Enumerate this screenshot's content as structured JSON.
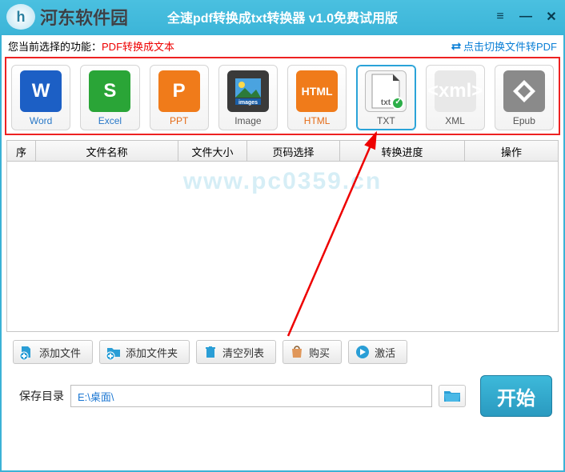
{
  "titlebar": {
    "brand": "河东软件园",
    "title": "全速pdf转换成txt转换器  v1.0免费试用版"
  },
  "watermark": "www.pc0359.cn",
  "funcbar": {
    "prefix": "您当前选择的功能：",
    "current": "PDF转换成文本",
    "switch_label": "点击切换文件转PDF"
  },
  "tiles": [
    {
      "label": "Word",
      "cls": "",
      "icon": "W"
    },
    {
      "label": "Excel",
      "cls": "",
      "icon": "S"
    },
    {
      "label": "PPT",
      "cls": "ppt",
      "icon": "P"
    },
    {
      "label": "Image",
      "cls": "other",
      "icon": "▣"
    },
    {
      "label": "HTML",
      "cls": "html",
      "icon": "HTML"
    },
    {
      "label": "TXT",
      "cls": "other",
      "icon": "txt",
      "selected": true
    },
    {
      "label": "XML",
      "cls": "other",
      "icon": "<xml>"
    },
    {
      "label": "Epub",
      "cls": "other",
      "icon": "◇"
    }
  ],
  "grid": {
    "headers": {
      "seq": "序",
      "fname": "文件名称",
      "fsize": "文件大小",
      "pagesel": "页码选择",
      "prog": "转换进度",
      "op": "操作"
    }
  },
  "buttons": {
    "add_file": "添加文件",
    "add_folder": "添加文件夹",
    "clear": "清空列表",
    "buy": "购买",
    "activate": "激活"
  },
  "bottom": {
    "save_label": "保存目录",
    "path": "E:\\桌面\\",
    "start": "开始"
  }
}
